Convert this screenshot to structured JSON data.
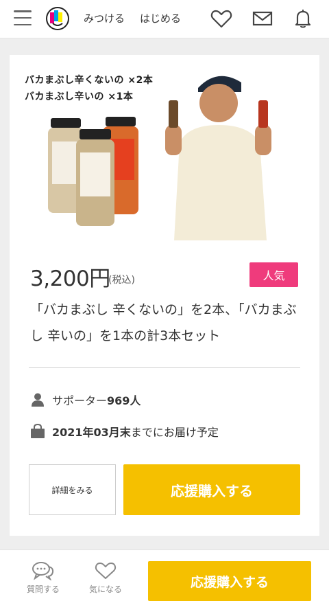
{
  "header": {
    "nav": [
      {
        "label": "みつける"
      },
      {
        "label": "はじめる"
      }
    ]
  },
  "product": {
    "image_text": {
      "line1": "バカまぶし辛くないの ×2本",
      "line2": "バカまぶし辛いの ×1本"
    },
    "price": "3,200円",
    "tax_label": "(税込)",
    "badge": "人気",
    "description": "「バカまぶし 辛くないの」を2本、「バカまぶし 辛いの」を1本の計3本セット",
    "supporters_label": "サポーター",
    "supporters_count": "969人",
    "delivery_date": "2021年03月末",
    "delivery_suffix": "までにお届け予定",
    "detail_button": "詳細をみる",
    "buy_button": "応援購入する"
  },
  "bottom_bar": {
    "question_label": "質問する",
    "favorite_label": "気になる",
    "buy_label": "応援購入する"
  },
  "colors": {
    "accent": "#f5c000",
    "badge": "#ef3b7c"
  }
}
